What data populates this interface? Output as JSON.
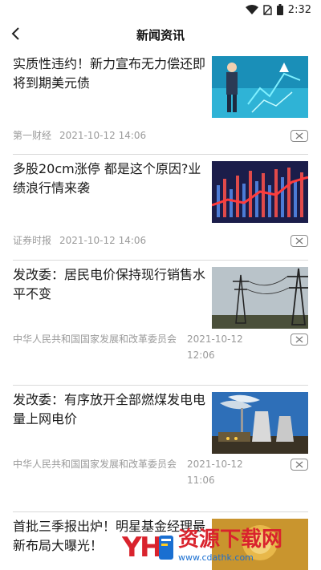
{
  "status_bar": {
    "time": "2:32"
  },
  "header": {
    "title": "新闻资讯"
  },
  "articles": [
    {
      "headline": "实质性违约！新力宣布无力偿还即将到期美元债",
      "source": "第一财经",
      "time": "2021-10-12 14:06"
    },
    {
      "headline": "多股20cm涨停 都是这个原因?业绩浪行情来袭",
      "source": "证券时报",
      "time": "2021-10-12 14:06"
    },
    {
      "headline": "发改委：居民电价保持现行销售水平不变",
      "source": "中华人民共和国国家发展和改革委员会",
      "time": "2021-10-12 12:06"
    },
    {
      "headline": "发改委：有序放开全部燃煤发电电量上网电价",
      "source": "中华人民共和国国家发展和改革委员会",
      "time": "2021-10-12 11:06"
    },
    {
      "headline": "首批三季报出炉！明星基金经理最新布局大曝光！",
      "source": "",
      "time": ""
    }
  ],
  "watermark": {
    "brand": "资源下载网",
    "url": "www.cdathk.com"
  },
  "colors": {
    "meta_text": "#9a9a9a",
    "divider": "#d9d9d9",
    "watermark_red": "#d9232d",
    "watermark_blue": "#1a6fd1"
  }
}
